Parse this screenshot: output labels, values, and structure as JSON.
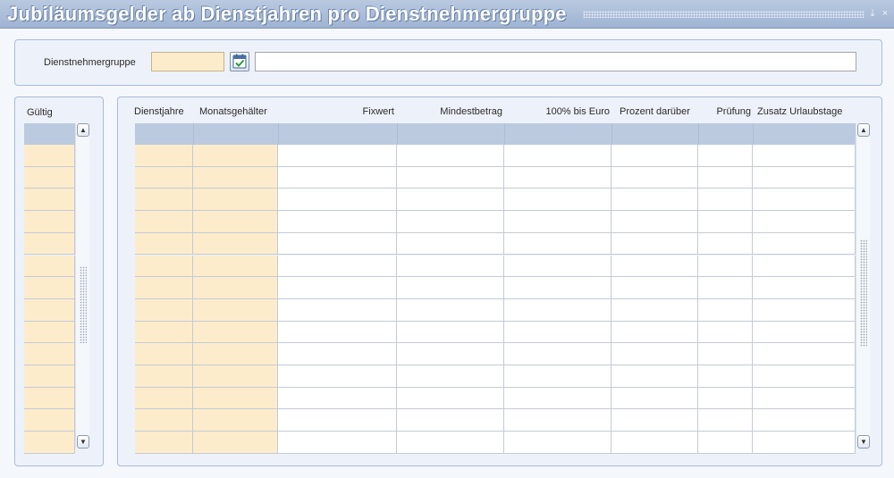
{
  "window": {
    "title": "Jubiläumsgelder ab Dienstjahren pro Dienstnehmergruppe",
    "minimize_glyph": "⤓",
    "close_glyph": "×"
  },
  "header_panel": {
    "group_label": "Dienstnehmergruppe",
    "group_code_value": "",
    "group_name_value": "",
    "lookup_icon": "calendar-check-icon"
  },
  "left_panel": {
    "title": "Gültig",
    "rows": [
      "",
      "",
      "",
      "",
      "",
      "",
      "",
      "",
      "",
      "",
      "",
      "",
      "",
      ""
    ]
  },
  "main_grid": {
    "columns": [
      {
        "key": "dienstjahre",
        "label": "Dienstjahre"
      },
      {
        "key": "monatsgehaelter",
        "label": "Monatsgehälter"
      },
      {
        "key": "fixwert",
        "label": "Fixwert"
      },
      {
        "key": "mindestbetrag",
        "label": "Mindestbetrag"
      },
      {
        "key": "prozent100",
        "label": "100% bis Euro"
      },
      {
        "key": "prozentdarueber",
        "label": "Prozent darüber"
      },
      {
        "key": "pruefung",
        "label": "Prüfung"
      },
      {
        "key": "urlaubstage",
        "label": "Zusatz Urlaubstage"
      }
    ],
    "row_count": 14
  },
  "colors": {
    "mandatory_field": "#fdeccb",
    "grid_header": "#bccadf",
    "title_bar": "#9fb3d2"
  }
}
